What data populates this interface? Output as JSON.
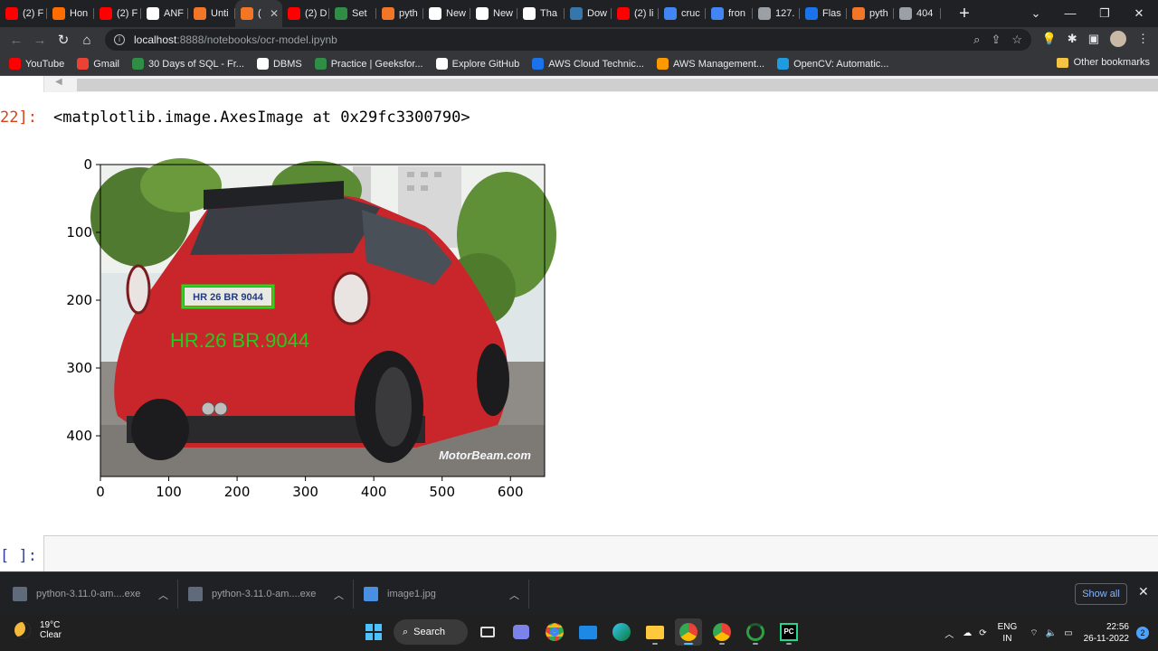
{
  "browser": {
    "tabs": [
      {
        "title": "(2) F",
        "icon": "youtube-icon",
        "color": "#ff0000"
      },
      {
        "title": "Hon",
        "icon": "hackerrank-icon",
        "color": "#ff6d00"
      },
      {
        "title": "(2) F",
        "icon": "youtube-icon",
        "color": "#ff0000"
      },
      {
        "title": "ANF",
        "icon": "github-icon",
        "color": "#ffffff"
      },
      {
        "title": "Unti",
        "icon": "jupyter-icon",
        "color": "#f37626"
      },
      {
        "title": "(",
        "icon": "jupyter-icon",
        "color": "#f37626",
        "active": true
      },
      {
        "title": "(2) D",
        "icon": "youtube-icon",
        "color": "#ff0000"
      },
      {
        "title": "Set",
        "icon": "geeksforgeeks-icon",
        "color": "#2f8d46"
      },
      {
        "title": "pyth",
        "icon": "jupyter-icon",
        "color": "#f37626"
      },
      {
        "title": "New",
        "icon": "github-icon",
        "color": "#ffffff"
      },
      {
        "title": "New",
        "icon": "github-icon",
        "color": "#ffffff"
      },
      {
        "title": "Tha",
        "icon": "jetbrains-icon",
        "color": "#ffffff"
      },
      {
        "title": "Dow",
        "icon": "python-icon",
        "color": "#3776ab"
      },
      {
        "title": "(2) li",
        "icon": "youtube-icon",
        "color": "#ff0000"
      },
      {
        "title": "cruc",
        "icon": "google-icon",
        "color": "#4285f4"
      },
      {
        "title": "fron",
        "icon": "google-icon",
        "color": "#4285f4"
      },
      {
        "title": "127.",
        "icon": "globe-icon",
        "color": "#9aa0a6"
      },
      {
        "title": "Flas",
        "icon": "flask-icon",
        "color": "#1a73e8"
      },
      {
        "title": "pyth",
        "icon": "jupyter-icon",
        "color": "#f37626"
      },
      {
        "title": "404",
        "icon": "globe-icon",
        "color": "#9aa0a6"
      }
    ],
    "url_host": "localhost",
    "url_path": ":8888/notebooks/ocr-model.ipynb",
    "bookmarks": [
      {
        "label": "YouTube",
        "icon": "youtube-icon",
        "color": "#ff0000"
      },
      {
        "label": "Gmail",
        "icon": "gmail-icon",
        "color": "#ea4335"
      },
      {
        "label": "30 Days of SQL - Fr...",
        "icon": "geeksforgeeks-icon",
        "color": "#2f8d46"
      },
      {
        "label": "DBMS",
        "icon": "notion-icon",
        "color": "#ffffff"
      },
      {
        "label": "Practice | Geeksfor...",
        "icon": "geeksforgeeks-icon",
        "color": "#2f8d46"
      },
      {
        "label": "Explore GitHub",
        "icon": "github-icon",
        "color": "#ffffff"
      },
      {
        "label": "AWS Cloud Technic...",
        "icon": "coursera-icon",
        "color": "#1a73e8"
      },
      {
        "label": "AWS Management...",
        "icon": "aws-icon",
        "color": "#ff9900"
      },
      {
        "label": "OpenCV: Automatic...",
        "icon": "opencv-icon",
        "color": "#1f9be0"
      }
    ],
    "other_bookmarks": "Other bookmarks"
  },
  "notebook": {
    "out_prompt": "22]:",
    "out_text": "<matplotlib.image.AxesImage at 0x29fc3300790>",
    "in_prompt": "[ ]:",
    "image_plate_text": "HR 26 BR 9044",
    "image_overlay_text": "HR.26 BR.9044",
    "image_watermark": "MotorBeam.com"
  },
  "chart_data": {
    "type": "image",
    "x_ticks": [
      0,
      100,
      200,
      300,
      400,
      500,
      600
    ],
    "y_ticks": [
      0,
      100,
      200,
      300,
      400
    ],
    "xlim": [
      0,
      650
    ],
    "ylim": [
      460,
      0
    ]
  },
  "downloads": {
    "items": [
      {
        "name": "python-3.11.0-am....exe",
        "icon": "installer-icon"
      },
      {
        "name": "python-3.11.0-am....exe",
        "icon": "installer-icon"
      },
      {
        "name": "image1.jpg",
        "icon": "image-file-icon"
      }
    ],
    "show_all": "Show all"
  },
  "taskbar": {
    "temperature": "19°C",
    "weather": "Clear",
    "search_label": "Search",
    "lang_top": "ENG",
    "lang_bottom": "IN",
    "time": "22:56",
    "date": "26-11-2022",
    "notification_count": "2"
  }
}
